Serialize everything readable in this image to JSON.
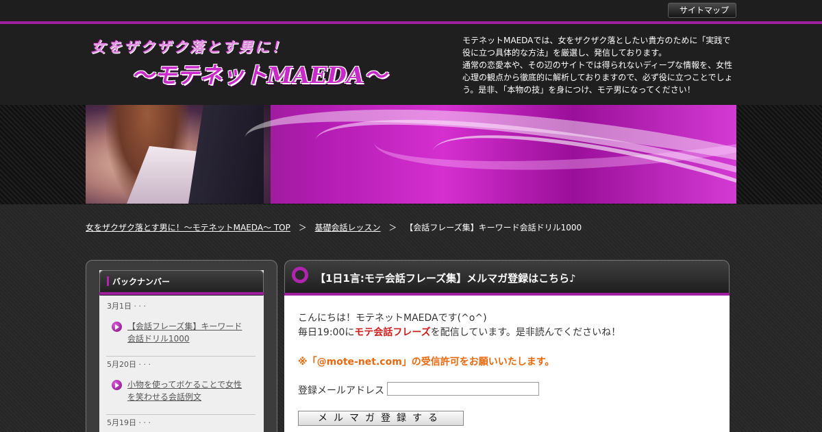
{
  "header": {
    "sitemap_label": "サイトマップ",
    "logo_line1": "女をザクザク落とす男に！",
    "logo_line2": "～モテネットMAEDA～",
    "intro_lines": [
      "モテネットMAEDAでは、女をザクザク落としたい貴方のために「実践で",
      "役に立つ具体的な方法」を厳選し、発信しております。",
      "通常の恋愛本や、その辺のサイトでは得られないディープな情報を、女性",
      "心理の観点から徹底的に解析しておりますので、必ず役に立つことでしょ",
      "う。是非、「本物の技」を身につけ、モテ男になってください！"
    ]
  },
  "breadcrumb": {
    "home": "女をザクザク落とす男に！～モテネットMAEDA～ TOP",
    "category": "基礎会話レッスン",
    "current": "【会話フレーズ集】キーワード会話ドリル1000",
    "separator": "＞"
  },
  "sidebar": {
    "title": "バックナンバー",
    "items": [
      {
        "date": "3月1日 · · ·",
        "title_lines": [
          "【会話フレーズ集】キーワード",
          "会話ドリル1000"
        ]
      },
      {
        "date": "5月20日 · · ·",
        "title_lines": [
          "小物を使ってボケることで女性",
          "を笑わせる会話例文"
        ]
      },
      {
        "date": "5月19日 · · ·",
        "title_lines": []
      }
    ]
  },
  "main": {
    "title": "【1日1言:モテ会話フレーズ集】メルマガ登録はこちら♪",
    "greeting": "こんにちは！モテネットMAEDAです(^o^)",
    "schedule_prefix": "毎日19:00に",
    "schedule_highlight": "モテ会話フレーズ",
    "schedule_suffix": "を配信しています。是非読んでくださいね！",
    "notice": "※「@mote-net.com」の受信許可をお願いいたします。",
    "email_label": "登録メールアドレス",
    "email_value": "",
    "submit_label": "メルマガ登録する"
  },
  "colors": {
    "accent": "#9e1fa0",
    "highlight": "#cc1b1b",
    "notice": "#e8690f"
  }
}
